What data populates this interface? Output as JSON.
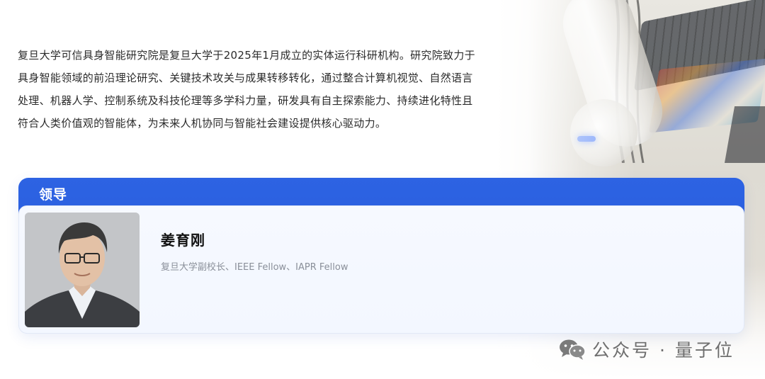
{
  "intro": {
    "lines": [
      "复旦大学可信具身智能研究院是复旦大学于2025年1月成立的实体运行科研机构。研究院致力于",
      "具身智能领域的前沿理论研究、关键技术攻关与成果转移转化，通过整合计算机视觉、自然语言",
      "处理、机器人学、控制系统及科技伦理等多学科力量，研发具有自主探索能力、持续进化特性且",
      "符合人类价值观的智能体，为未来人机协同与智能社会建设提供核心驱动力。"
    ]
  },
  "leadership": {
    "heading": "领导",
    "leader": {
      "name": "姜育刚",
      "title": "复旦大学副校长、IEEE Fellow、IAPR Fellow",
      "photo_icon": "portrait-photo"
    }
  },
  "watermark": {
    "icon": "wechat-icon",
    "text": "公众号 · 量子位"
  },
  "colors": {
    "accent": "#2d63e3",
    "card_bg": "#f4f8ff",
    "text": "#2b2b2b",
    "muted": "#8a8f99"
  }
}
